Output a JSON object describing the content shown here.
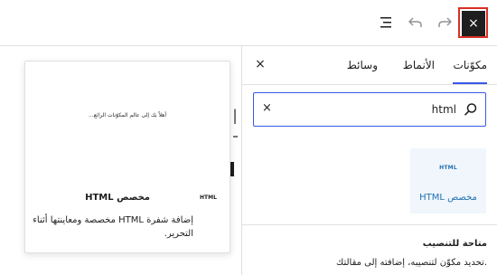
{
  "toolbar": {
    "close_symbol": "×",
    "icons": [
      "document-overview-icon",
      "undo-icon",
      "redo-icon",
      "close-icon"
    ]
  },
  "inserter": {
    "tabs": [
      {
        "label": "مكوّنات",
        "active": true
      },
      {
        "label": "الأنماط",
        "active": false
      },
      {
        "label": "وسائط",
        "active": false
      }
    ],
    "close_symbol": "×",
    "search": {
      "value": "html",
      "clear_symbol": "×"
    },
    "results": [
      {
        "thumb_label": "HTML",
        "title": "HTML مخصص"
      }
    ],
    "installable": {
      "title": "متاحة للتنصيب",
      "description": "تحديد مكوّن لتنصيبه، إضافته إلى مقالتك."
    }
  },
  "preview": {
    "sample_text": "...أهلاً بك إلى عالم المكوّنات الرائع",
    "icon_label": "HTML",
    "title": "HTML مخصص",
    "description": "إضافة شفرة HTML مخصصة ومعاينتها أثناء التحرير."
  },
  "editor": {
    "partial_glyph": "ا"
  },
  "colors": {
    "accent": "#3858e9",
    "link": "#2271b1",
    "dark": "#1e1e1e",
    "highlight_outline": "#d93025",
    "block_bg": "#f0f6fc"
  }
}
